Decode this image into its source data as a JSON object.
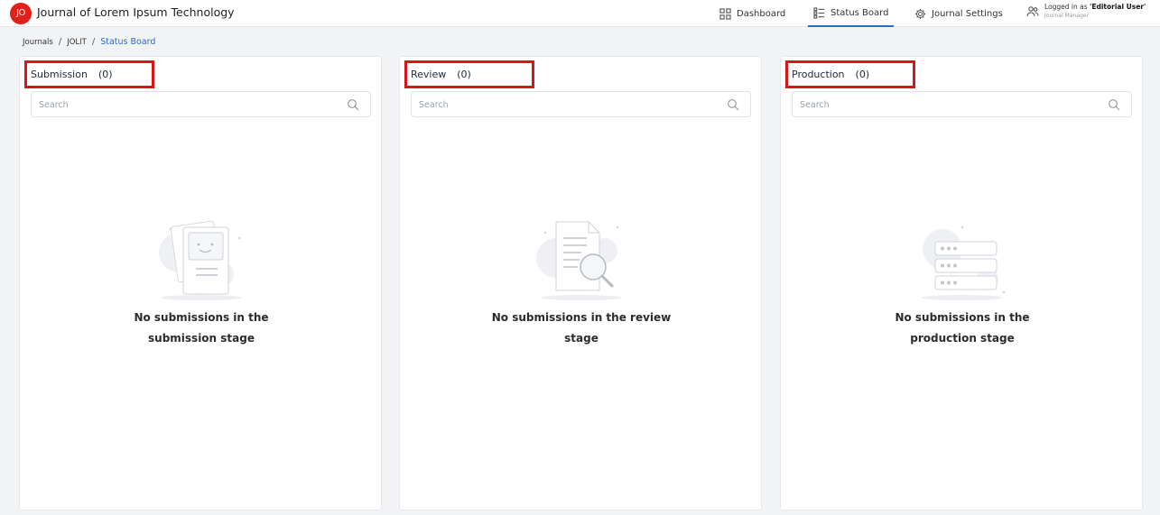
{
  "header": {
    "logo_initials": "JO",
    "app_title": "Journal of Lorem Ipsum Technology",
    "nav": [
      {
        "label": "Dashboard",
        "icon": "grid-icon",
        "active": false
      },
      {
        "label": "Status Board",
        "icon": "list-board-icon",
        "active": true
      },
      {
        "label": "Journal Settings",
        "icon": "gear-icon",
        "active": false
      }
    ],
    "user": {
      "logged_in_prefix": "Logged in as ",
      "name": "'Editorial User'",
      "role": "Journal Manager"
    }
  },
  "breadcrumb": {
    "items": [
      "Journals",
      "JOLIT"
    ],
    "separator": "/",
    "current": "Status Board"
  },
  "columns": [
    {
      "title": "Submission",
      "count": "(0)",
      "search_placeholder": "Search",
      "empty_line1": "No submissions in the",
      "empty_line2": "submission stage",
      "illustration": "smiley-document-illustration"
    },
    {
      "title": "Review",
      "count": "(0)",
      "search_placeholder": "Search",
      "empty_line1": "No submissions in the review",
      "empty_line2": "stage",
      "illustration": "magnifier-document-illustration"
    },
    {
      "title": "Production",
      "count": "(0)",
      "search_placeholder": "Search",
      "empty_line1": "No submissions in the",
      "empty_line2": "production stage",
      "illustration": "server-stack-illustration"
    }
  ],
  "colors": {
    "brand_red": "#e0211b",
    "active_blue": "#2b6cc4",
    "highlight_red": "#d9151c"
  }
}
